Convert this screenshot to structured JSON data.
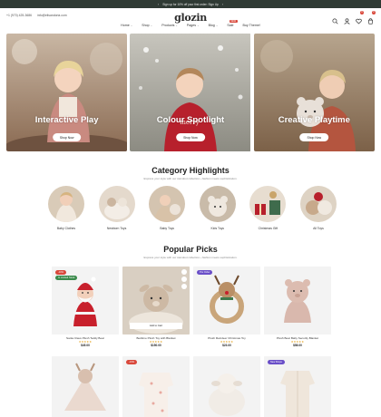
{
  "announcement": {
    "text": "Sign up for 10% off your first order: Sign Up"
  },
  "header": {
    "phone": "+1 (970) 425-3686",
    "email": "info@elisandoria.com",
    "logo": "glozin",
    "cart_count": "0",
    "wishlist_count": "0"
  },
  "nav": {
    "items": [
      {
        "label": "Home"
      },
      {
        "label": "Shop"
      },
      {
        "label": "Products"
      },
      {
        "label": "Pages"
      },
      {
        "label": "Blog"
      },
      {
        "label": "Sale"
      },
      {
        "label": "Buy Theme!"
      }
    ],
    "new_tag": "NEW"
  },
  "hero": [
    {
      "title": "Interactive Play",
      "button": "Shop Now"
    },
    {
      "title": "Colour Spotlight",
      "button": "Shop Now"
    },
    {
      "title": "Creative Playtime",
      "button": "Shop Now"
    }
  ],
  "categories": {
    "title": "Category Highlights",
    "subtitle": "Express your style with our standout collection—fashion meets sophistication.",
    "items": [
      {
        "label": "Baby Clothes"
      },
      {
        "label": "Newborn Toys"
      },
      {
        "label": "Baby Toys"
      },
      {
        "label": "Kids Toys"
      },
      {
        "label": "Christmas Gift"
      },
      {
        "label": "All Toys"
      }
    ]
  },
  "popular": {
    "title": "Popular Picks",
    "subtitle": "Express your style with our standout collection—fashion meets sophistication.",
    "add_to_cart": "Add to Cart",
    "products": [
      {
        "name": "Santa Claus Plush Teddy Bear",
        "stars": "★★★★★",
        "price": "$45.00",
        "tag": "-10%",
        "tag2": "In Limited Stock",
        "tag_color": "#d9483b"
      },
      {
        "name": "Bedtime Plush Toy with Blanket",
        "stars": "★★★★★",
        "price": "$150.00",
        "tag": "",
        "tag_color": ""
      },
      {
        "name": "Plush Reindeer Christmas Toy",
        "stars": "★★★★★",
        "price": "$23.00",
        "tag": "Pre Order",
        "tag_color": "#6a4fc8"
      },
      {
        "name": "Plush Bear Baby Security Blanket",
        "stars": "★★★★★",
        "price": "$58.00",
        "tag": "",
        "tag_color": ""
      },
      {
        "name": "",
        "stars": "",
        "price": "",
        "tag": "",
        "tag_color": ""
      },
      {
        "name": "",
        "stars": "",
        "price": "",
        "tag": "-13%",
        "tag_color": "#d9483b"
      },
      {
        "name": "",
        "stars": "",
        "price": "",
        "tag": "",
        "tag_color": ""
      },
      {
        "name": "",
        "stars": "",
        "price": "",
        "tag": "New Drops",
        "tag_color": "#6a4fc8"
      }
    ]
  }
}
